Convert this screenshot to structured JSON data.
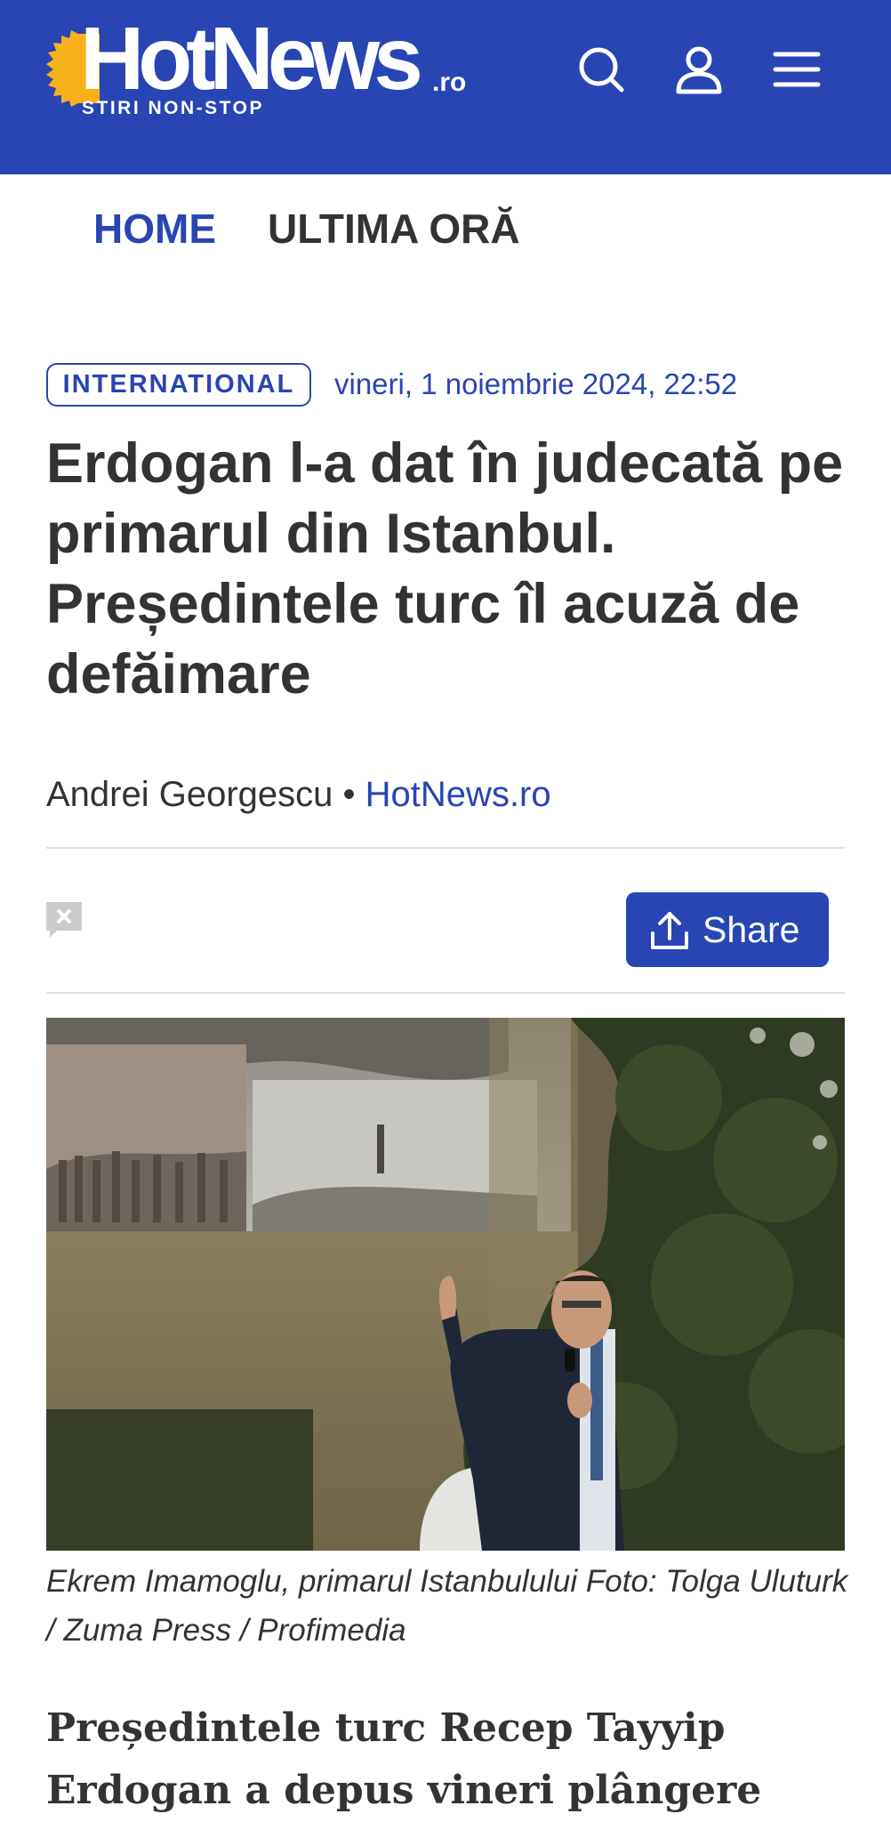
{
  "header": {
    "logo_text": "HotNews",
    "logo_suffix": ".ro",
    "tagline": "STIRI NON-STOP",
    "icons": [
      "search-icon",
      "user-icon",
      "hamburger-menu-icon"
    ],
    "brand_color": "#2845b3",
    "logo_accent_color": "#f7b21b"
  },
  "nav": {
    "items": [
      {
        "label": "HOME",
        "active": true
      },
      {
        "label": "ULTIMA ORĂ",
        "active": false
      }
    ]
  },
  "article": {
    "category": "INTERNATIONAL",
    "date": "vineri, 1 noiembrie 2024, 22:52",
    "title": "Erdogan l-a dat în judecată pe primarul din Istanbul. Președintele turc îl acuză de defăimare",
    "author": "Andrei Georgescu",
    "separator": "•",
    "source": "HotNews.ro",
    "actions": {
      "comments_icon": "comment-disabled-icon",
      "share_label": "Share",
      "share_icon": "upload-share-icon"
    },
    "image_caption": "Ekrem Imamoglu, primarul Istanbulului Foto: Tolga Uluturk / Zuma Press / Profimedia",
    "lead": "Președintele turc Recep Tayyip Erdogan a depus vineri plângere"
  }
}
